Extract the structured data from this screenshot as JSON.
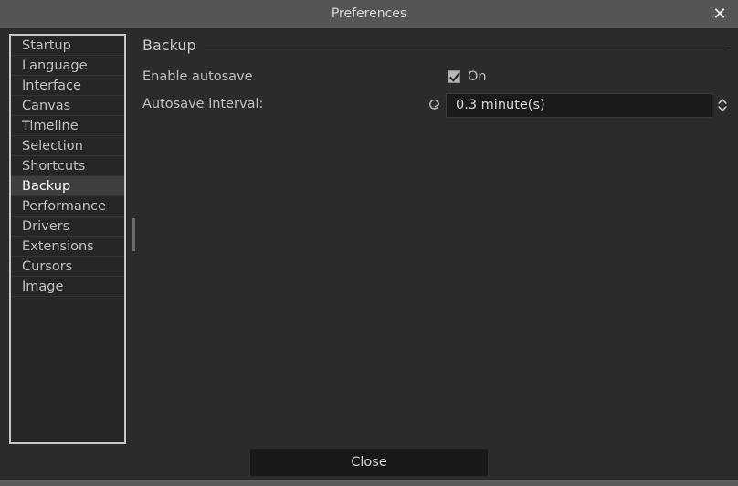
{
  "window": {
    "title": "Preferences",
    "close_icon": "close-icon"
  },
  "sidebar": {
    "items": [
      {
        "label": "Startup",
        "selected": false
      },
      {
        "label": "Language",
        "selected": false
      },
      {
        "label": "Interface",
        "selected": false
      },
      {
        "label": "Canvas",
        "selected": false
      },
      {
        "label": "Timeline",
        "selected": false
      },
      {
        "label": "Selection",
        "selected": false
      },
      {
        "label": "Shortcuts",
        "selected": false
      },
      {
        "label": "Backup",
        "selected": true
      },
      {
        "label": "Performance",
        "selected": false
      },
      {
        "label": "Drivers",
        "selected": false
      },
      {
        "label": "Extensions",
        "selected": false
      },
      {
        "label": "Cursors",
        "selected": false
      },
      {
        "label": "Image",
        "selected": false
      }
    ]
  },
  "content": {
    "group_title": "Backup",
    "enable_autosave": {
      "label": "Enable autosave",
      "checked": true,
      "state_text": "On"
    },
    "autosave_interval": {
      "label": "Autosave interval:",
      "value": "0.3 minute(s)",
      "reset_icon": "reset-icon",
      "stepper_icon": "up-down-chevron-icon"
    }
  },
  "footer": {
    "close_label": "Close"
  },
  "colors": {
    "titlebar": "#555555",
    "dialog_bg": "#2b2b2b",
    "list_bg": "#262626",
    "list_border": "#c8c8c8",
    "selected_row": "#3e3e3e",
    "field_bg": "#1b1b1b",
    "button_bg": "#191919",
    "text": "#c0c0c0",
    "text_bright": "#ffffff",
    "bottom_strip": "#5a5a5a"
  }
}
